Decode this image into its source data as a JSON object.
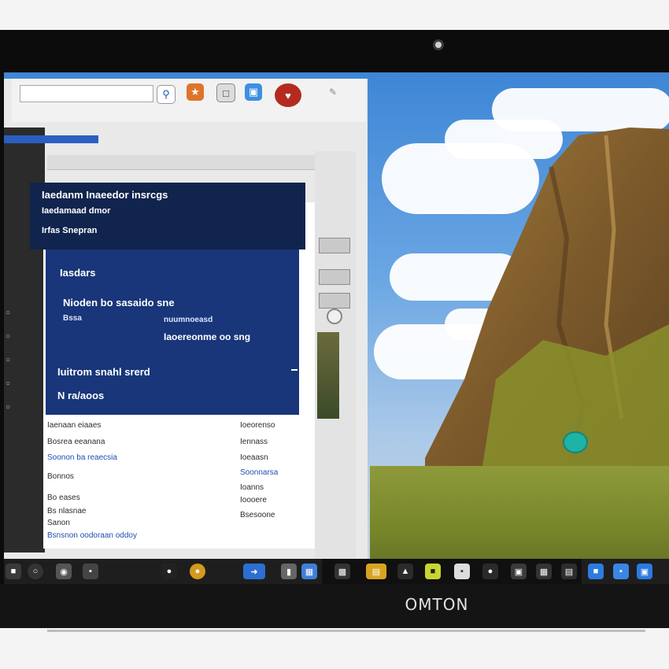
{
  "brand": "OMTON",
  "search": {
    "value": ""
  },
  "toolbar": {
    "icons": [
      "orange-app-icon",
      "document-icon",
      "blue-app-icon",
      "red-app-icon"
    ],
    "labels": [
      "",
      "",
      ""
    ]
  },
  "panel_header": {
    "line1": "Iaedanm Inaeedor insrcgs",
    "line2": "Iaedamaad dmor",
    "line3": "Irfas Snepran"
  },
  "panel": {
    "title": "Iasdars",
    "line1": "Nioden bo sasaido sne",
    "line2a": "Bssa",
    "line2b": "nuumnoeasd",
    "line3": "Iaoereonme oo sng",
    "line4": "Iuitrom snahl srerd",
    "line5": "N ra/aoos"
  },
  "rows": {
    "left": [
      "Iaenaan eiaaes",
      "Bosrea eeanana",
      "Soonon ba reaecsia",
      "Bonnos",
      "Bo eases",
      "Bs nlasnae",
      "Sanon",
      "Bsnsnon oodoraan oddoy"
    ],
    "right": [
      "Ioeorenso",
      "Iennass",
      "Ioeaasn",
      "Soonnarsa",
      "Ioanns",
      "Ioooere",
      "Bsesoone"
    ]
  },
  "colors": {
    "panel_dark": "#11244e",
    "panel_blue": "#183679",
    "taskbar": "#1e1e1e",
    "bezel": "#0c0c0c"
  }
}
